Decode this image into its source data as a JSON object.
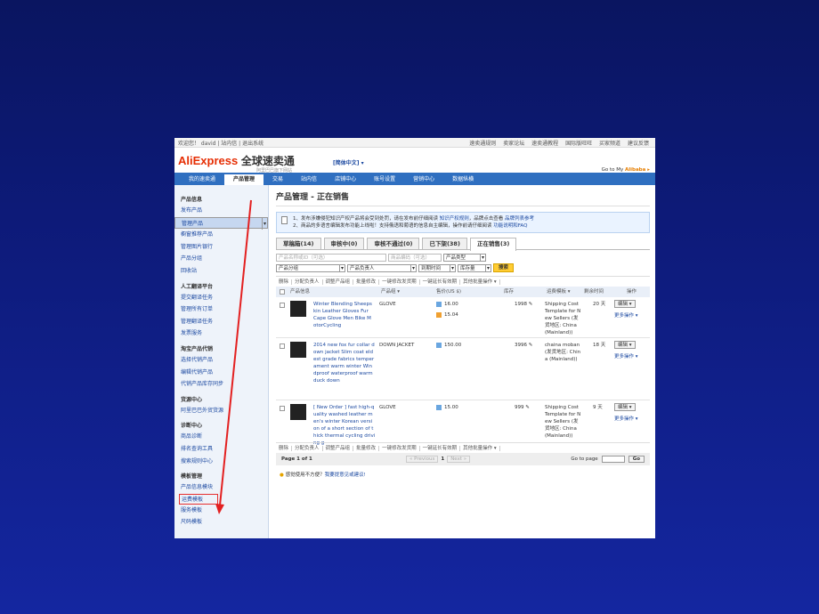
{
  "topbar": {
    "greeting": "欢迎您！ david | 站内信 | 退出系统",
    "links": [
      "速卖通规则",
      "卖家论坛",
      "速卖通教程",
      "国际版旺旺",
      "买家频道",
      "建议反馈"
    ]
  },
  "brand": {
    "logo": "AliExpress",
    "logo_cn": "全球速卖通",
    "sub": "阿里巴巴旗下网站",
    "lang": "[简体中文] ▾",
    "goto_prefix": "Go to My ",
    "goto_brand": "Alibaba ▸"
  },
  "nav": [
    "我的速卖通",
    "产品管理",
    "交易",
    "站内信",
    "店铺中心",
    "账号设置",
    "营销中心",
    "数据纵横"
  ],
  "sidebar": [
    {
      "type": "h",
      "label": "产品信息"
    },
    {
      "type": "i",
      "label": "发布产品"
    },
    {
      "type": "i",
      "label": "管理产品",
      "sel": true
    },
    {
      "type": "i",
      "label": "橱窗推荐产品"
    },
    {
      "type": "i",
      "label": "管理图片银行"
    },
    {
      "type": "i",
      "label": "产品分组"
    },
    {
      "type": "i",
      "label": "回收站"
    },
    {
      "type": "h",
      "label": "人工翻译平台"
    },
    {
      "type": "i",
      "label": "提交翻译任务"
    },
    {
      "type": "i",
      "label": "管理所有订单"
    },
    {
      "type": "i",
      "label": "管理翻译任务"
    },
    {
      "type": "i",
      "label": "发票服务"
    },
    {
      "type": "h",
      "label": "淘宝产品代销"
    },
    {
      "type": "i",
      "label": "选择代销产品"
    },
    {
      "type": "i",
      "label": "编辑代销产品"
    },
    {
      "type": "i",
      "label": "代销产品库存同步"
    },
    {
      "type": "h",
      "label": "货源中心"
    },
    {
      "type": "i",
      "label": "阿里巴巴外贸货源"
    },
    {
      "type": "h",
      "label": "诊断中心"
    },
    {
      "type": "i",
      "label": "商品诊断"
    },
    {
      "type": "i",
      "label": "排名查询工具"
    },
    {
      "type": "i",
      "label": "搜索规则中心"
    },
    {
      "type": "h",
      "label": "模板管理"
    },
    {
      "type": "i",
      "label": "产品信息模块"
    },
    {
      "type": "i",
      "label": "运费模板",
      "boxed": true
    },
    {
      "type": "i",
      "label": "服务模板"
    },
    {
      "type": "i",
      "label": "尺码模板"
    }
  ],
  "page_title": "产品管理 - 正在销售",
  "notice": {
    "line1": "1、发布涉嫌侵犯知识产权产品将会受到处罚，请在发布前仔细阅读",
    "line1_link1": "知识产权规则",
    "line1_mid": "，品牌点击查看",
    "line1_link2": "品牌列表参考",
    "line2": "2、商品的多语言编辑发布功能上线啦！支持俄语和葡语的信息自主编辑，操作前请仔细阅读",
    "line2_link": "功能说明和FAQ"
  },
  "tabs": [
    "草稿箱(14)",
    "审核中(0)",
    "审核不通过(0)",
    "已下架(38)",
    "正在销售(3)"
  ],
  "filters": {
    "name_placeholder": "产品名称或ID（可选）",
    "code_placeholder": "商品编码（可选）",
    "type": "产品类型",
    "group": "产品分组",
    "owner": "产品负责人",
    "time": "到期时间",
    "stock": "库存量",
    "search": "搜索"
  },
  "batch": [
    "删除",
    "分配负责人",
    "调整产品组",
    "批量修改",
    "一键修改发货期",
    "一键延长有效期",
    "其他批量操作 ▾"
  ],
  "thead": {
    "info": "产品信息",
    "group": "产品组 ▾",
    "price": "售价(US $)",
    "stock": "库存",
    "tpl": "运费模板 ▾",
    "remain": "剩余时间",
    "op": "操作"
  },
  "rows": [
    {
      "title": [
        "Winter Blending Sheeps",
        "kin Leather Gloves Fur",
        "Cape Glove Men Bike M",
        "otorCycling"
      ],
      "group": "GLOVE",
      "prices": [
        "16.00",
        "15.04"
      ],
      "stock": "1998",
      "tpl": [
        "Shipping Cost",
        "Template for N",
        "ew Sellers (发",
        "货地区: China",
        "(Mainland))"
      ],
      "remain": "20 天",
      "edit": "编辑",
      "more": "更多操作 ▾"
    },
    {
      "title": [
        "2014 new fox fur collar d",
        "own jacket Slim coat eld",
        "est grade fabrics temper",
        "ament warm winter Win",
        "dproof waterproof warm",
        "duck down"
      ],
      "group": "DOWN JACKET",
      "prices": [
        "150.00"
      ],
      "stock": "3996",
      "tpl": [
        "chaina moban",
        "(发货地区: Chin",
        "a (Mainland))"
      ],
      "remain": "18 天",
      "edit": "编辑",
      "more": "更多操作 ▾"
    },
    {
      "title": [
        "[ New Order ] fast high-q",
        "uality washed leather m",
        "en's winter Korean versi",
        "on of a short section of t",
        "hick thermal cycling drivi",
        "ng g"
      ],
      "group": "GLOVE",
      "prices": [
        "15.00"
      ],
      "stock": "999",
      "tpl": [
        "Shipping Cost",
        "Template for N",
        "ew Sellers (发",
        "货地区: China",
        "(Mainland))"
      ],
      "remain": "9 天",
      "edit": "编辑",
      "more": "更多操作 ▾"
    }
  ],
  "pager": {
    "page": "Page 1 of 1",
    "prev": "« Previous",
    "num": "1",
    "next": "Next »",
    "goto": "Go to page",
    "go": "Go"
  },
  "feedback": {
    "text": "感觉使用不方便？",
    "link": "我要提意见或建议!"
  }
}
